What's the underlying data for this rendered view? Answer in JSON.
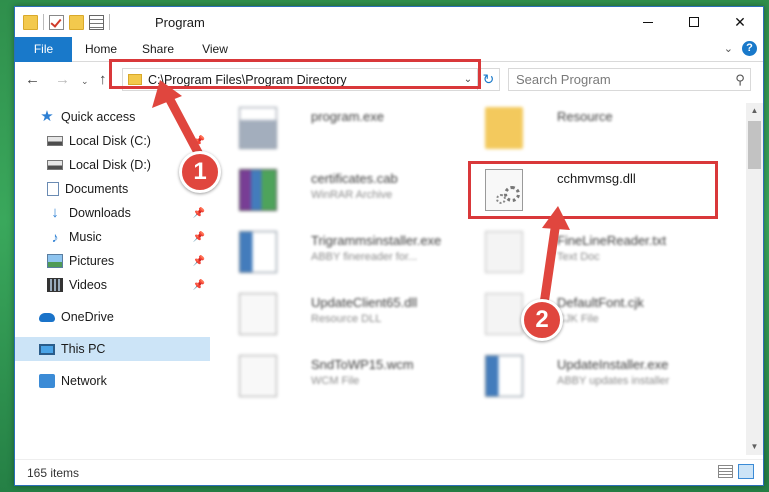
{
  "window": {
    "title": "Program",
    "controls": {
      "minimize": "–",
      "maximize": "☐",
      "close": "✕"
    }
  },
  "ribbon": {
    "tabs": [
      "File",
      "Home",
      "Share",
      "View"
    ],
    "expand": "⌄",
    "help": "?"
  },
  "nav": {
    "back": "←",
    "forward": "→",
    "recent": "⌄",
    "up": "↑",
    "address": "C:\\Program Files\\Program Directory",
    "address_dropdown": "⌄",
    "refresh": "↻",
    "search_placeholder": "Search Program",
    "search_icon": "⚲"
  },
  "sidebar": {
    "items": [
      {
        "label": "Quick access",
        "icon": "star-icon",
        "pinned": false
      },
      {
        "label": "Local Disk (C:)",
        "icon": "disk-icon",
        "pinned": true
      },
      {
        "label": "Local Disk (D:)",
        "icon": "disk-icon",
        "pinned": false
      },
      {
        "label": "Documents",
        "icon": "documents-icon",
        "pinned": false
      },
      {
        "label": "Downloads",
        "icon": "download-icon",
        "pinned": true
      },
      {
        "label": "Music",
        "icon": "music-icon",
        "pinned": true
      },
      {
        "label": "Pictures",
        "icon": "pictures-icon",
        "pinned": true
      },
      {
        "label": "Videos",
        "icon": "videos-icon",
        "pinned": true
      },
      {
        "label": "OneDrive",
        "icon": "onedrive-icon",
        "pinned": false
      },
      {
        "label": "This PC",
        "icon": "this-pc-icon",
        "pinned": false,
        "selected": true
      },
      {
        "label": "Network",
        "icon": "network-icon",
        "pinned": false
      }
    ],
    "pin_glyph": "📌"
  },
  "files": [
    {
      "name": "program.exe",
      "type": "",
      "icon": "exe-icon"
    },
    {
      "name": "Resource",
      "type": "",
      "icon": "folder-icon"
    },
    {
      "name": "certificates.cab",
      "type": "WinRAR Archive",
      "icon": "rar-icon"
    },
    {
      "name": "cchmvmsg.dll",
      "type": "",
      "icon": "dll-icon",
      "highlighted": true
    },
    {
      "name": "Trigrammsinstaller.exe",
      "type": "ABBY finereader for...",
      "icon": "app-icon"
    },
    {
      "name": "FineLineReader.txt",
      "type": "Text Doc",
      "icon": "document-icon"
    },
    {
      "name": "UpdateClient65.dll",
      "type": "Resource DLL",
      "icon": "dll-icon"
    },
    {
      "name": "DefaultFont.cjk",
      "type": "CJK File",
      "icon": "document-icon"
    },
    {
      "name": "SndToWP15.wcm",
      "type": "WCM File",
      "icon": "dll-icon"
    },
    {
      "name": "UpdateInstaller.exe",
      "type": "ABBY updates installer",
      "icon": "app-icon"
    }
  ],
  "status": {
    "items_count": "165 items"
  },
  "annotations": {
    "step1": "1",
    "step2": "2",
    "color": "#e0463e"
  },
  "colors": {
    "accent": "#1979ca",
    "selection": "#cce4f7",
    "highlight_box": "#d9383a"
  }
}
